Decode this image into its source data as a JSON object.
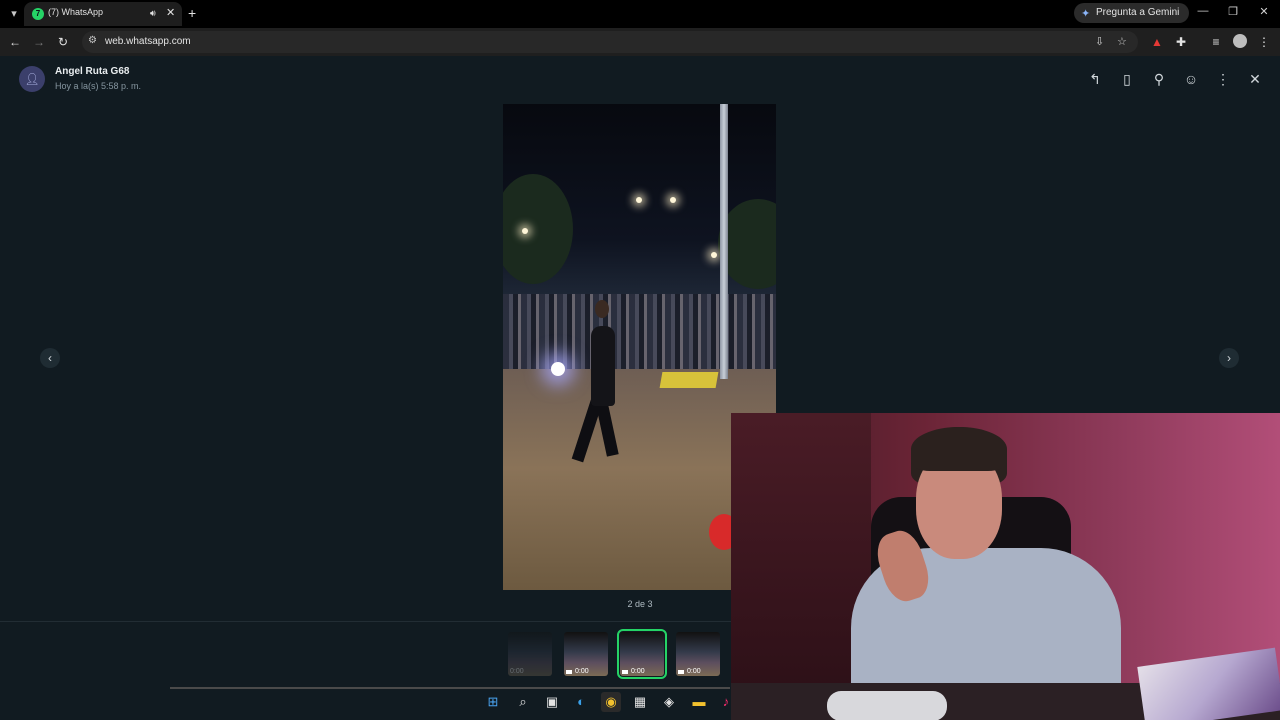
{
  "browser": {
    "tab": {
      "title": "(7) WhatsApp",
      "favicon_badge": "7"
    },
    "gemini_button": "Pregunta a Gemini",
    "url": "web.whatsapp.com"
  },
  "viewer": {
    "sender_name": "Angel Ruta G68",
    "timestamp": "Hoy a la(s) 5:58 p. m.",
    "counter": "2 de 3",
    "thumbnails": [
      {
        "duration": "0:00",
        "state": "dim"
      },
      {
        "duration": "0:00",
        "state": "normal"
      },
      {
        "duration": "0:00",
        "state": "active"
      },
      {
        "duration": "0:00",
        "state": "normal"
      }
    ]
  },
  "icons": {
    "tab_list": "chevron-down-icon",
    "favicon": "whatsapp-icon",
    "audio": "speaker-icon",
    "close_tab": "close-icon",
    "new_tab": "plus-icon",
    "back": "arrow-left-icon",
    "forward": "arrow-right-icon",
    "reload": "reload-icon",
    "site_info": "tune-icon",
    "install": "install-icon",
    "bookmark": "star-icon",
    "pdf_ext": "pdf-icon",
    "extensions": "puzzle-icon",
    "media": "media-controls-icon",
    "profile": "avatar-icon",
    "menu": "kebab-icon",
    "reply": "reply-icon",
    "save": "bookmark-icon",
    "pin": "pin-icon",
    "react": "emoji-icon",
    "more": "kebab-icon",
    "close_viewer": "close-icon",
    "prev": "chevron-left-icon",
    "next": "chevron-right-icon"
  },
  "colors": {
    "accent": "#25d366",
    "viewer_bg": "#111b21",
    "chrome_bg": "#1f1f1f"
  }
}
